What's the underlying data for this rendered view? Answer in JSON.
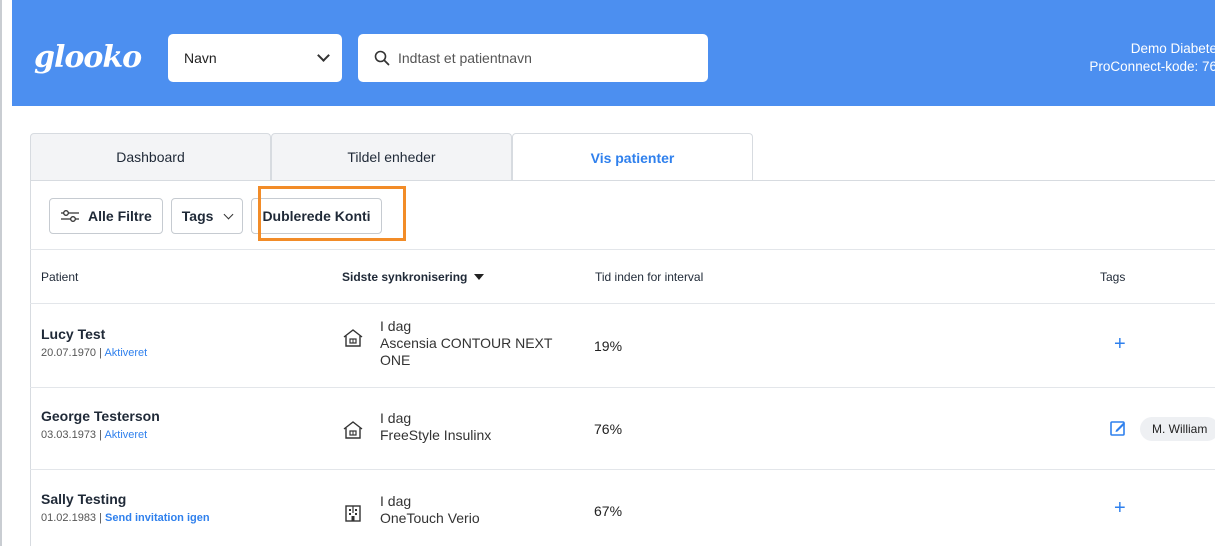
{
  "header": {
    "logo": "glooko",
    "select_value": "Navn",
    "search_placeholder": "Indtast et patientnavn",
    "account_line1": "Demo Diabete",
    "account_line2": "ProConnect-kode: 76",
    "bg_color": "#4c8ff0"
  },
  "tabs": [
    {
      "label": "Dashboard"
    },
    {
      "label": "Tildel enheder"
    },
    {
      "label": "Vis patienter"
    }
  ],
  "filters": {
    "all_filters": "Alle Filtre",
    "tags": "Tags",
    "duplicates": "Dublerede Konti"
  },
  "columns": {
    "patient": "Patient",
    "last_sync": "Sidste synkronisering",
    "tir": "Tid inden for interval",
    "tags": "Tags"
  },
  "rows": [
    {
      "name": "Lucy Test",
      "dob": "20.07.1970",
      "sep": " | ",
      "status": "Aktiveret",
      "sync_day": "I dag",
      "device": "Ascensia CONTOUR NEXT ONE",
      "tir": "19%"
    },
    {
      "name": "George Testerson",
      "dob": "03.03.1973",
      "sep": " | ",
      "status": "Aktiveret",
      "sync_day": "I dag",
      "device": "FreeStyle Insulinx",
      "tir": "76%",
      "tag": "M. William"
    },
    {
      "name": "Sally Testing",
      "dob": "01.02.1983",
      "sep": " | ",
      "status": "Send invitation igen",
      "sync_day": "I dag",
      "device": "OneTouch Verio",
      "tir": "67%"
    }
  ],
  "icons": {
    "search": "search-icon",
    "filter": "sliders-icon",
    "home": "home-icon",
    "clinic": "building-icon",
    "plus": "plus-icon",
    "edit": "edit-icon",
    "sort": "sort-down-icon"
  },
  "plus_glyph": "+",
  "accent": "#2f80ed",
  "highlight_color": "#f28c28"
}
